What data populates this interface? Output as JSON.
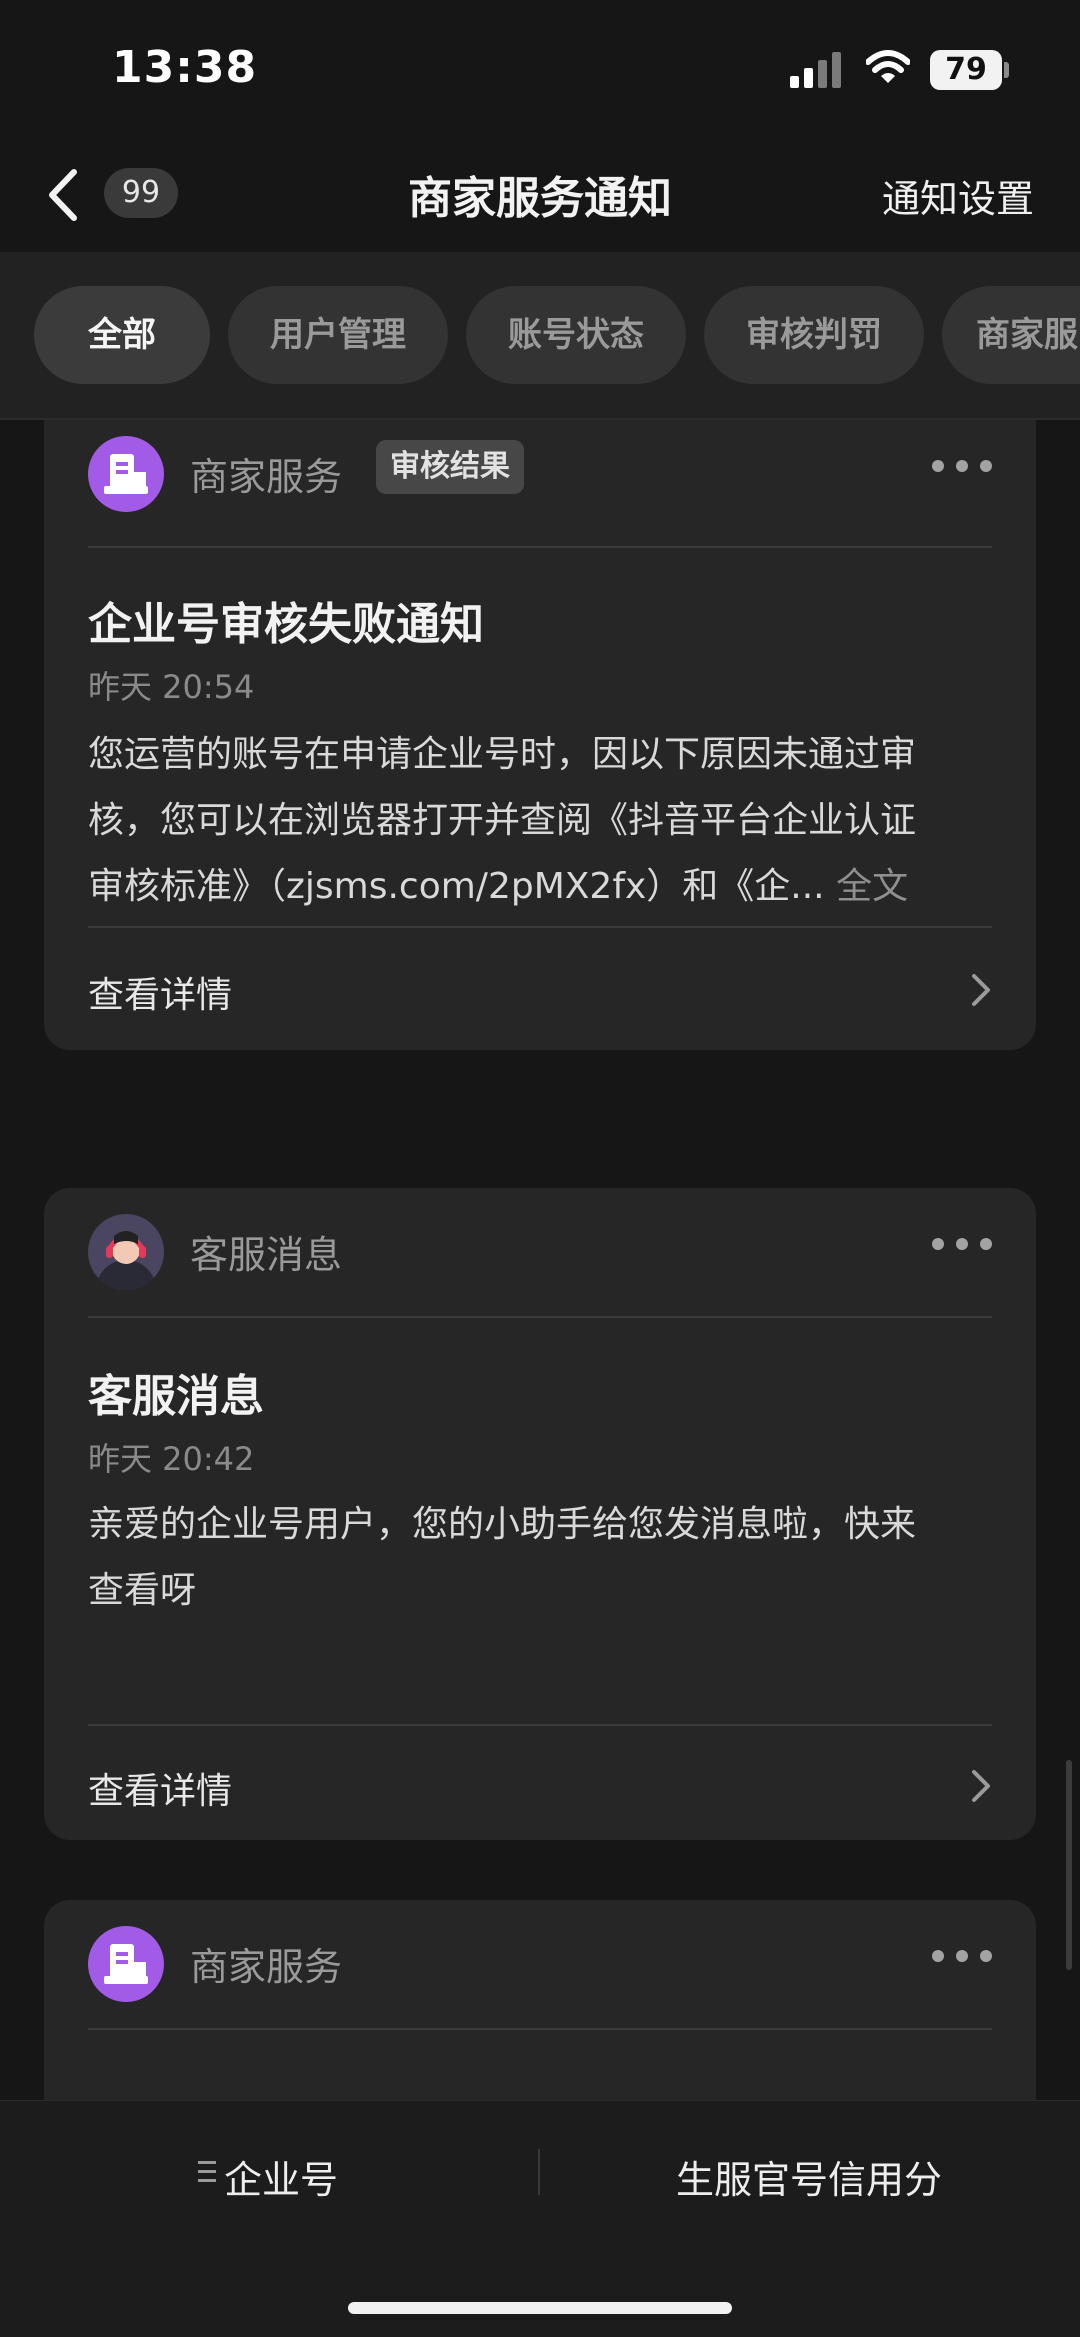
{
  "status_bar": {
    "time": "13:38",
    "battery": "79"
  },
  "nav": {
    "unread_badge": "99",
    "title": "商家服务通知",
    "settings_label": "通知设置"
  },
  "tabs": [
    {
      "label": "全部",
      "active": true
    },
    {
      "label": "用户管理",
      "active": false
    },
    {
      "label": "账号状态",
      "active": false
    },
    {
      "label": "审核判罚",
      "active": false
    },
    {
      "label": "商家服",
      "active": false
    }
  ],
  "cards": [
    {
      "source": "商家服务",
      "tag": "审核结果",
      "title": "企业号审核失败通知",
      "time": "昨天 20:54",
      "body_lines": [
        "您运营的账号在申请企业号时，因以下原因未通过审",
        "核，您可以在浏览器打开并查阅《抖音平台企业认证",
        "审核标准》（zjsms.com/2pMX2fx）和《企..."
      ],
      "fulltext_label": "全文",
      "detail_label": "查看详情"
    },
    {
      "source": "客服消息",
      "title": "客服消息",
      "time": "昨天 20:42",
      "body_lines": [
        "亲爱的企业号用户，您的小助手给您发消息啦，快来",
        "查看呀"
      ],
      "detail_label": "查看详情"
    },
    {
      "source": "商家服务"
    }
  ],
  "bottom_bar": {
    "left_label": "企业号",
    "right_label": "生服官号信用分"
  },
  "colors": {
    "accent_purple": "#a15be6",
    "background": "#161616",
    "card": "#262626"
  },
  "icons": [
    "back-arrow-icon",
    "signal-icon",
    "wifi-icon",
    "battery-icon",
    "merchant-service-icon",
    "customer-service-avatar",
    "more-dots-icon",
    "chevron-right-icon",
    "menu-lines-icon"
  ]
}
